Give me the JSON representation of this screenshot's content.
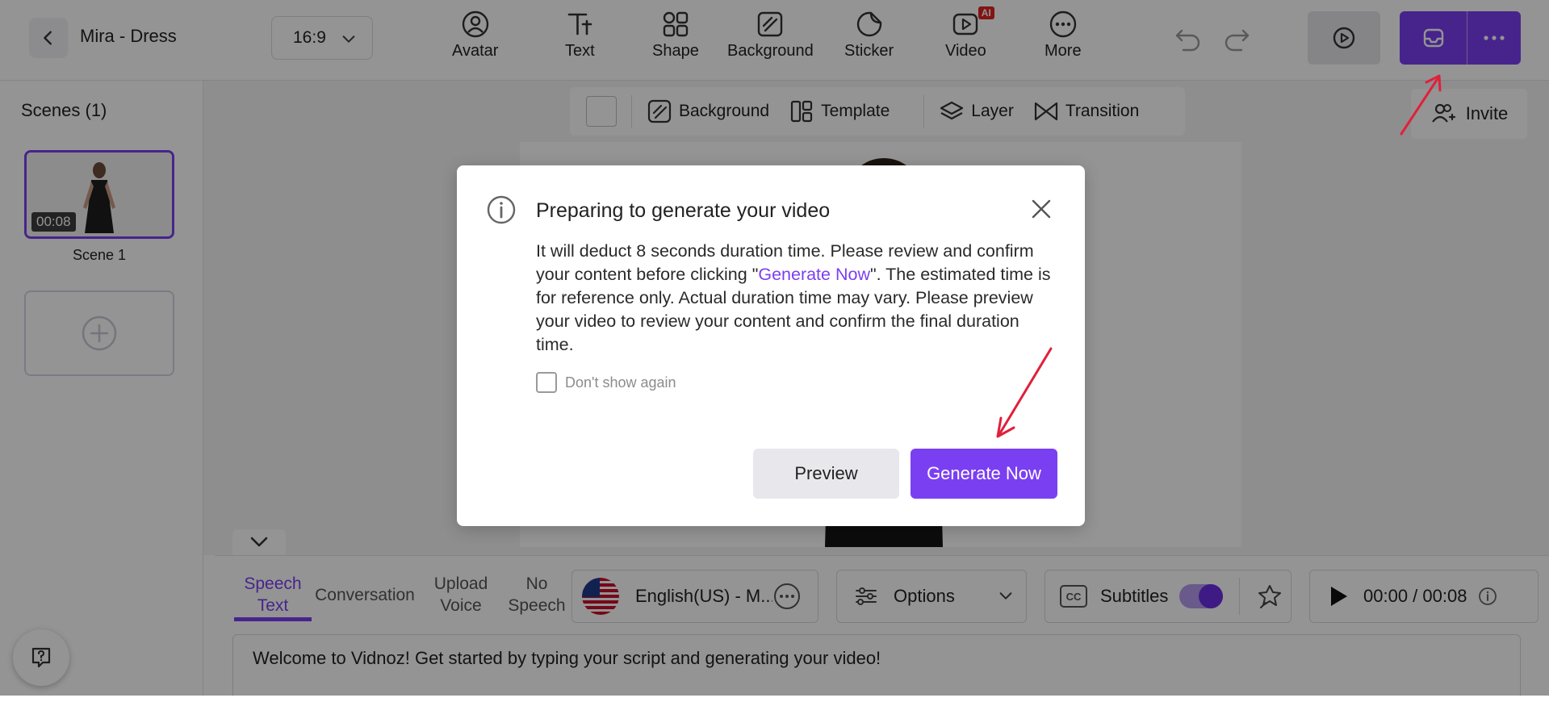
{
  "header": {
    "project_title": "Mira - Dress",
    "aspect_ratio": "16:9",
    "tools": [
      {
        "label": "Avatar",
        "icon": "avatar-icon"
      },
      {
        "label": "Text",
        "icon": "text-icon"
      },
      {
        "label": "Shape",
        "icon": "shape-icon"
      },
      {
        "label": "Background",
        "icon": "background-icon"
      },
      {
        "label": "Sticker",
        "icon": "sticker-icon"
      },
      {
        "label": "Video",
        "icon": "video-icon",
        "badge": "AI"
      },
      {
        "label": "More",
        "icon": "more-icon"
      }
    ]
  },
  "scenes": {
    "title": "Scenes (1)",
    "items": [
      {
        "label": "Scene 1",
        "duration": "00:08"
      }
    ]
  },
  "canvas_toolbar": {
    "background": "Background",
    "template": "Template",
    "layer": "Layer",
    "transition": "Transition"
  },
  "invite_label": "Invite",
  "editor": {
    "tabs": [
      {
        "label_line1": "Speech",
        "label_line2": "Text",
        "active": true
      },
      {
        "label_line1": "Conversation",
        "label_line2": ""
      },
      {
        "label_line1": "Upload",
        "label_line2": "Voice"
      },
      {
        "label_line1": "No",
        "label_line2": "Speech"
      }
    ],
    "voice": "English(US) - M...",
    "options_label": "Options",
    "subtitles_label": "Subtitles",
    "subtitles_on": true,
    "time": "00:00 / 00:08",
    "script": "Welcome to Vidnoz! Get started by typing your script and generating your video!"
  },
  "dialog": {
    "title": "Preparing to generate your video",
    "body_before_link": "It will deduct 8 seconds duration time. Please review and confirm your content before clicking \"",
    "body_link": "Generate Now",
    "body_after_link": "\". The estimated time is for reference only. Actual duration time may vary. Please preview your video to review your content and confirm the final duration time.",
    "dont_show_label": "Don't show again",
    "preview_label": "Preview",
    "generate_label": "Generate Now"
  },
  "colors": {
    "accent": "#7b3ff2",
    "annotation_arrow": "#e0203a"
  }
}
